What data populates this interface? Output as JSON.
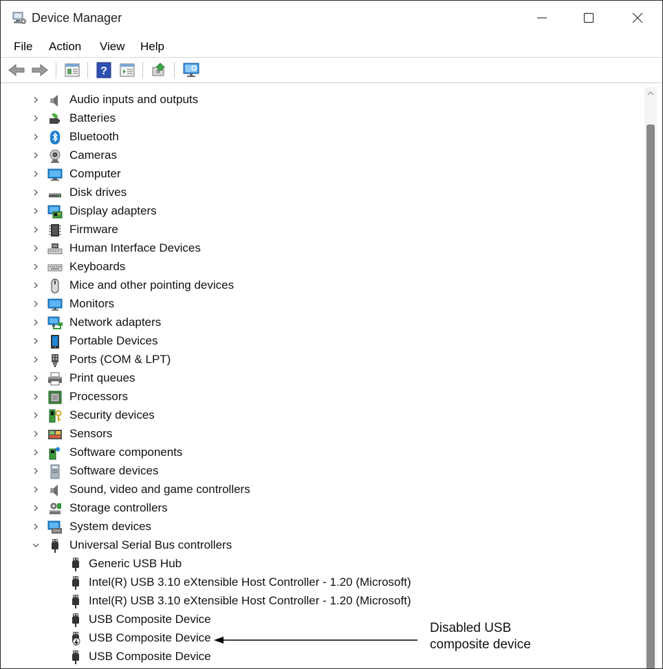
{
  "window": {
    "title": "Device Manager",
    "controls": [
      "minimize",
      "maximize",
      "close"
    ]
  },
  "menu": [
    "File",
    "Action",
    "View",
    "Help"
  ],
  "toolbar": {
    "icons": [
      "back-arrow-icon",
      "forward-arrow-icon",
      "properties-icon",
      "help-icon",
      "action-pane-icon",
      "update-driver-icon",
      "scan-hardware-icon"
    ]
  },
  "tree": {
    "categories": [
      {
        "label": "Audio inputs and outputs",
        "icon": "speaker-icon",
        "expanded": false
      },
      {
        "label": "Batteries",
        "icon": "battery-icon",
        "expanded": false
      },
      {
        "label": "Bluetooth",
        "icon": "bluetooth-icon",
        "expanded": false
      },
      {
        "label": "Cameras",
        "icon": "camera-icon",
        "expanded": false
      },
      {
        "label": "Computer",
        "icon": "computer-icon",
        "expanded": false
      },
      {
        "label": "Disk drives",
        "icon": "disk-drive-icon",
        "expanded": false
      },
      {
        "label": "Display adapters",
        "icon": "display-adapter-icon",
        "expanded": false
      },
      {
        "label": "Firmware",
        "icon": "firmware-icon",
        "expanded": false
      },
      {
        "label": "Human Interface Devices",
        "icon": "hid-icon",
        "expanded": false
      },
      {
        "label": "Keyboards",
        "icon": "keyboard-icon",
        "expanded": false
      },
      {
        "label": "Mice and other pointing devices",
        "icon": "mouse-icon",
        "expanded": false
      },
      {
        "label": "Monitors",
        "icon": "monitor-icon",
        "expanded": false
      },
      {
        "label": "Network adapters",
        "icon": "network-adapter-icon",
        "expanded": false
      },
      {
        "label": "Portable Devices",
        "icon": "portable-device-icon",
        "expanded": false
      },
      {
        "label": "Ports (COM & LPT)",
        "icon": "port-icon",
        "expanded": false
      },
      {
        "label": "Print queues",
        "icon": "printer-icon",
        "expanded": false
      },
      {
        "label": "Processors",
        "icon": "processor-icon",
        "expanded": false
      },
      {
        "label": "Security devices",
        "icon": "security-device-icon",
        "expanded": false
      },
      {
        "label": "Sensors",
        "icon": "sensor-icon",
        "expanded": false
      },
      {
        "label": "Software components",
        "icon": "software-component-icon",
        "expanded": false
      },
      {
        "label": "Software devices",
        "icon": "software-device-icon",
        "expanded": false
      },
      {
        "label": "Sound, video and game controllers",
        "icon": "speaker-icon",
        "expanded": false
      },
      {
        "label": "Storage controllers",
        "icon": "storage-controller-icon",
        "expanded": false
      },
      {
        "label": "System devices",
        "icon": "system-device-icon",
        "expanded": false
      },
      {
        "label": "Universal Serial Bus controllers",
        "icon": "usb-icon",
        "expanded": true
      }
    ],
    "usb_children": [
      {
        "label": "Generic USB Hub",
        "icon": "usb-icon",
        "disabled": false
      },
      {
        "label": "Intel(R) USB 3.10 eXtensible Host Controller - 1.20 (Microsoft)",
        "icon": "usb-icon",
        "disabled": false
      },
      {
        "label": "Intel(R) USB 3.10 eXtensible Host Controller - 1.20 (Microsoft)",
        "icon": "usb-icon",
        "disabled": false
      },
      {
        "label": "USB Composite Device",
        "icon": "usb-icon",
        "disabled": false
      },
      {
        "label": "USB Composite Device",
        "icon": "usb-disabled-icon",
        "disabled": true
      },
      {
        "label": "USB Composite Device",
        "icon": "usb-icon",
        "disabled": false
      }
    ]
  },
  "annotation": {
    "line1": "Disabled USB",
    "line2": "composite device"
  },
  "colors": {
    "accent_blue": "#1e7fd0",
    "scroll_thumb": "#898989"
  }
}
